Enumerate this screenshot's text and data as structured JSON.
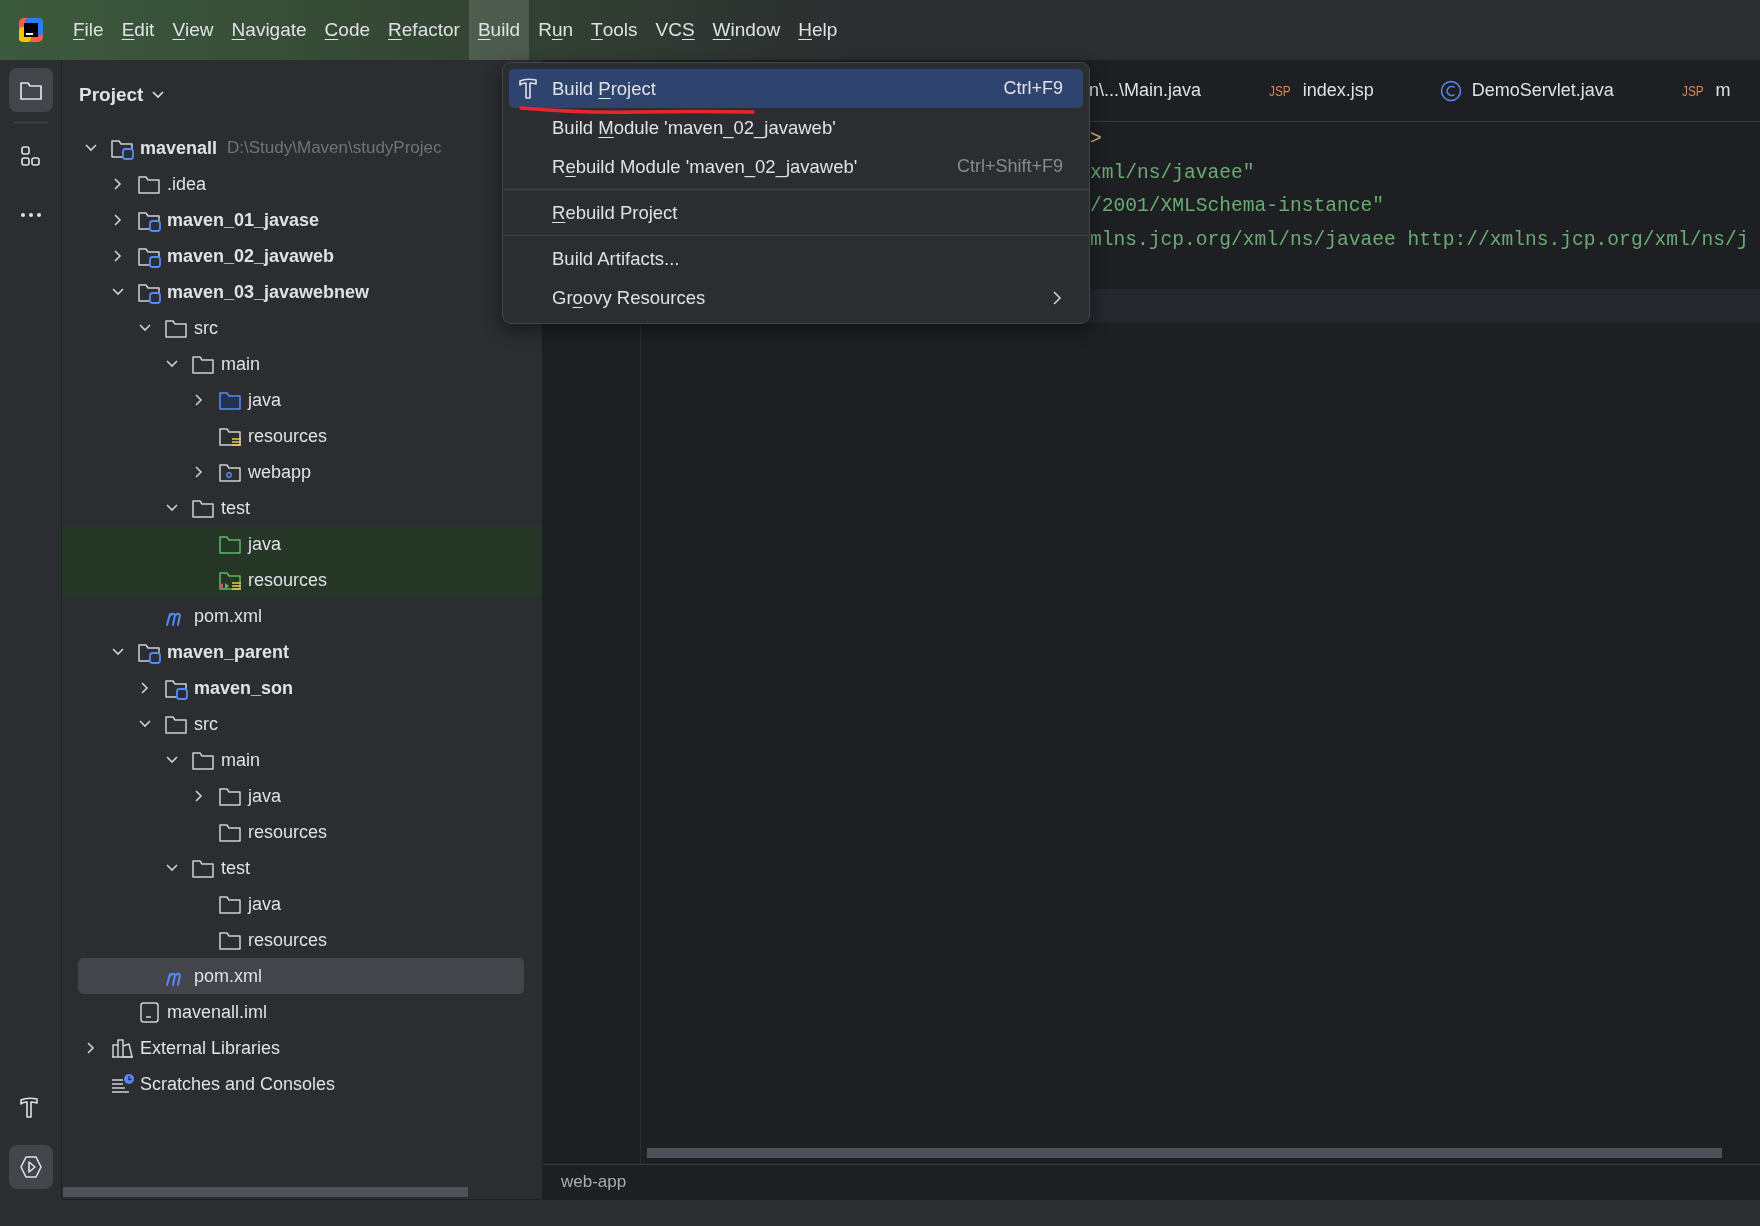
{
  "menu_bar": {
    "items": [
      {
        "key": "F",
        "post": "ile",
        "selected": false
      },
      {
        "key": "E",
        "post": "dit",
        "selected": false
      },
      {
        "key": "V",
        "post": "iew",
        "selected": false
      },
      {
        "key": "N",
        "post": "avigate",
        "selected": false
      },
      {
        "key": "C",
        "post": "ode",
        "selected": false
      },
      {
        "key": "R",
        "post": "efactor",
        "selected": false
      },
      {
        "key": "B",
        "post": "uild",
        "selected": true
      },
      {
        "pre": "R",
        "key": "u",
        "post": "n",
        "selected": false
      },
      {
        "key": "T",
        "post": "ools",
        "selected": false
      },
      {
        "pre": "VC",
        "key": "S",
        "selected": false
      },
      {
        "key": "W",
        "post": "indow",
        "selected": false
      },
      {
        "key": "H",
        "post": "elp",
        "selected": false
      }
    ]
  },
  "tool_strip": {
    "top": [
      {
        "kind": "project",
        "selected": true
      },
      {
        "kind": "structure",
        "selected": false
      },
      {
        "kind": "more",
        "selected": false
      }
    ],
    "bottom": [
      {
        "kind": "build",
        "selected": false
      },
      {
        "kind": "services",
        "selected": true
      }
    ]
  },
  "project_panel": {
    "title": "Project",
    "tree": [
      {
        "label": "mavenall",
        "kind": "module",
        "hint": "D:\\Study\\Maven\\studyProjec",
        "expanded": true,
        "selected": false,
        "children": [
          {
            "label": ".idea",
            "kind": "folder",
            "expanded": false,
            "selected": false
          },
          {
            "label": "maven_01_javase",
            "kind": "module",
            "expanded": false,
            "selected": false
          },
          {
            "label": "maven_02_javaweb",
            "kind": "module",
            "expanded": false,
            "selected": false
          },
          {
            "label": "maven_03_javawebnew",
            "kind": "module",
            "expanded": true,
            "selected": false,
            "children": [
              {
                "label": "src",
                "kind": "folder",
                "expanded": true,
                "selected": false,
                "children": [
                  {
                    "label": "main",
                    "kind": "folder",
                    "expanded": true,
                    "selected": false,
                    "children": [
                      {
                        "label": "java",
                        "kind": "source",
                        "expanded": false,
                        "selected": false
                      },
                      {
                        "label": "resources",
                        "kind": "resources",
                        "selected": false
                      },
                      {
                        "label": "webapp",
                        "kind": "web",
                        "expanded": false,
                        "selected": false
                      }
                    ]
                  },
                  {
                    "label": "test",
                    "kind": "folder",
                    "expanded": true,
                    "selected": false,
                    "children": [
                      {
                        "label": "java",
                        "kind": "test-source",
                        "selected": false
                      },
                      {
                        "label": "resources",
                        "kind": "test-resources",
                        "selected": false
                      }
                    ]
                  }
                ]
              },
              {
                "label": "pom.xml",
                "kind": "maven",
                "selected": false
              }
            ]
          },
          {
            "label": "maven_parent",
            "kind": "module",
            "expanded": true,
            "selected": false,
            "children": [
              {
                "label": "maven_son",
                "kind": "module",
                "expanded": false,
                "selected": false
              },
              {
                "label": "src",
                "kind": "folder",
                "expanded": true,
                "selected": false,
                "children": [
                  {
                    "label": "main",
                    "kind": "folder",
                    "expanded": true,
                    "selected": false,
                    "children": [
                      {
                        "label": "java",
                        "kind": "folder",
                        "expanded": false,
                        "selected": false
                      },
                      {
                        "label": "resources",
                        "kind": "folder",
                        "selected": false
                      }
                    ]
                  },
                  {
                    "label": "test",
                    "kind": "folder",
                    "expanded": true,
                    "selected": false,
                    "children": [
                      {
                        "label": "java",
                        "kind": "folder",
                        "selected": false
                      },
                      {
                        "label": "resources",
                        "kind": "folder",
                        "selected": false
                      }
                    ]
                  }
                ]
              },
              {
                "label": "pom.xml",
                "kind": "maven",
                "selected": true
              }
            ]
          },
          {
            "label": "mavenall.iml",
            "kind": "iml",
            "selected": false
          }
        ]
      },
      {
        "label": "External Libraries",
        "kind": "libraries",
        "expanded": false,
        "selected": false
      },
      {
        "label": "Scratches and Consoles",
        "kind": "scratches",
        "selected": false
      }
    ]
  },
  "editor": {
    "tabs": [
      {
        "kind": "plain",
        "label": "n\\...\\Main.java"
      },
      {
        "kind": "jsp",
        "badge": "JSP",
        "label": "index.jsp"
      },
      {
        "kind": "class",
        "label": "DemoServlet.java"
      },
      {
        "kind": "jsp",
        "badge": "JSP",
        "label": "m"
      }
    ],
    "code_lines": [
      {
        "kind": "tag",
        "text": ">"
      },
      {
        "kind": "string",
        "text": "xml/ns/javaee\""
      },
      {
        "kind": "string",
        "text": "/2001/XMLSchema-instance\""
      },
      {
        "kind": "string",
        "text": "mlns.jcp.org/xml/ns/javaee http://xmlns.jcp.org/xml/ns/j"
      }
    ],
    "breadcrumb": "web-app"
  },
  "build_menu": {
    "items": [
      {
        "kind": "icon-command",
        "pre": "Build ",
        "key": "P",
        "post": "roject",
        "shortcut": "Ctrl+F9",
        "selected": true
      },
      {
        "kind": "command",
        "pre": "Build ",
        "key": "M",
        "post": "odule 'maven_02_javaweb'",
        "selected": false
      },
      {
        "kind": "command",
        "pre": "R",
        "key": "e",
        "post": "build Module 'maven_02_javaweb'",
        "shortcut": "Ctrl+Shift+F9",
        "selected": false
      },
      {
        "kind": "separator"
      },
      {
        "kind": "command",
        "key": "R",
        "post": "ebuild Project",
        "selected": false
      },
      {
        "kind": "separator"
      },
      {
        "kind": "command",
        "pre": "Build Artifacts...",
        "selected": false
      },
      {
        "kind": "submenu",
        "pre": "Gr",
        "key": "o",
        "post": "ovy Resources",
        "selected": false
      }
    ]
  }
}
